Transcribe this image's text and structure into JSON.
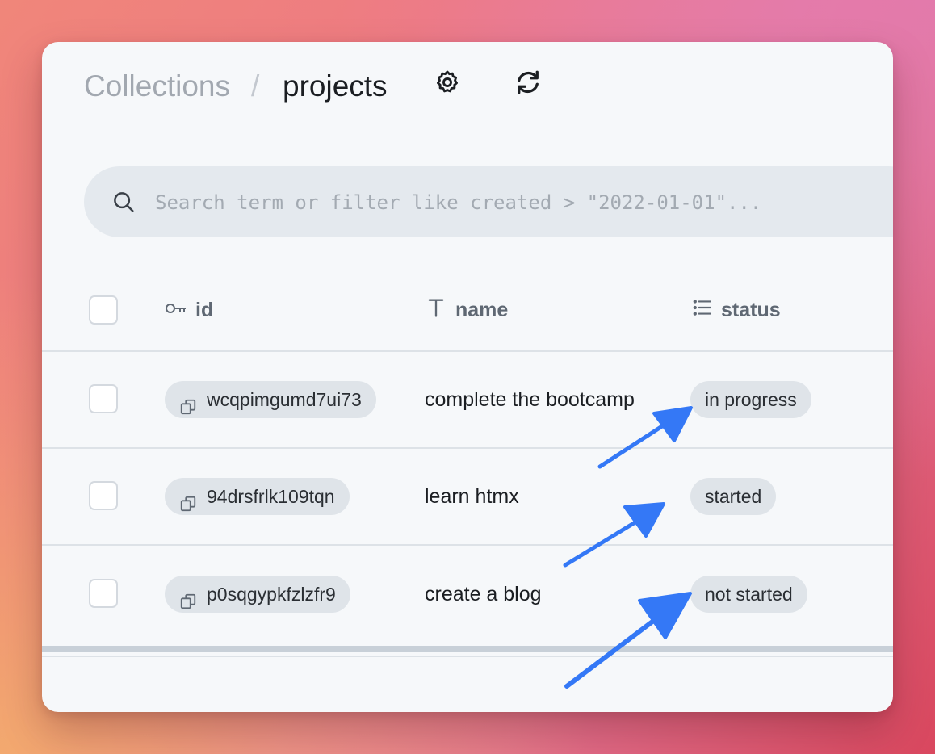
{
  "breadcrumb": {
    "parent": "Collections",
    "separator": "/",
    "current": "projects"
  },
  "header": {
    "settings_icon": "gear-icon",
    "refresh_icon": "refresh-icon"
  },
  "search": {
    "placeholder": "Search term or filter like created > \"2022-01-01\"...",
    "value": "",
    "icon": "search-icon"
  },
  "table": {
    "columns": [
      {
        "key": "id",
        "label": "id",
        "icon": "key-icon"
      },
      {
        "key": "name",
        "label": "name",
        "icon": "text-type-icon"
      },
      {
        "key": "status",
        "label": "status",
        "icon": "list-icon"
      }
    ],
    "rows": [
      {
        "id": "wcqpimgumd7ui73",
        "name": "complete the bootcamp",
        "status": "in progress"
      },
      {
        "id": "94drsfrlk109tqn",
        "name": "learn htmx",
        "status": "started"
      },
      {
        "id": "p0sqgypkfzlzfr9",
        "name": "create a blog",
        "status": "not started"
      }
    ]
  },
  "annotation_color": "#3478f6",
  "colors": {
    "window_bg": "#f6f8fa",
    "pill_bg": "#dfe4e9",
    "muted_text": "#a2a8b0"
  }
}
